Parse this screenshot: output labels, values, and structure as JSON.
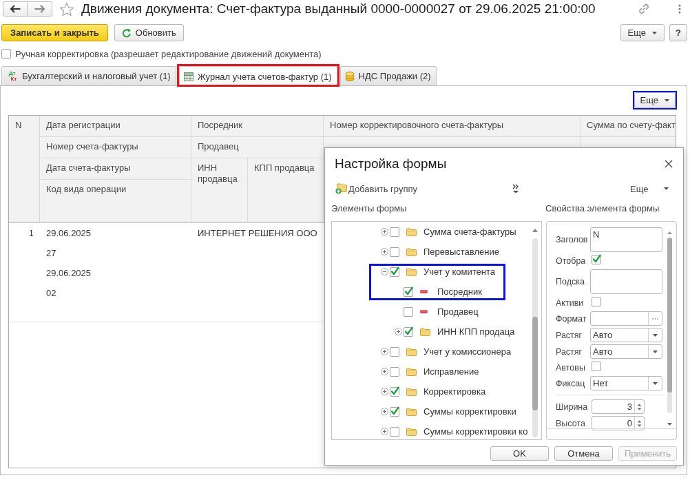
{
  "window": {
    "title": "Движения документа: Счет-фактура выданный 0000-0000027 от 29.06.2025 21:00:00"
  },
  "toolbar": {
    "buttons": [
      {
        "label": "Записать и закрыть",
        "kind": "primary"
      },
      {
        "label": "Обновить",
        "kind": "secondary"
      }
    ],
    "more_button": "Еще",
    "help_button": "?"
  },
  "manual_edit": {
    "label": "Ручная корректировка (разрешает редактирование движений документа)",
    "checked": false
  },
  "tabs": [
    {
      "label": "Бухгалтерский и налоговый учет (1)",
      "badge": [
        "Дт",
        "Кт"
      ],
      "selected": false,
      "highlighted": false
    },
    {
      "label": "Журнал учета счетов-фактур (1)",
      "selected": true,
      "highlighted": true
    },
    {
      "label": "НДС Продажи (2)",
      "selected": false,
      "highlighted": false
    }
  ],
  "table": {
    "more_button": {
      "label": "Еще",
      "highlighted": true
    },
    "columns": [
      {
        "lines": [
          "N"
        ]
      },
      {
        "lines": [
          "Дата регистрации",
          "Номер счета-фактуры",
          "Дата счета-фактуры",
          "Код вида операции"
        ]
      },
      {
        "lines": [
          "Посредник",
          "Продавец"
        ],
        "sub_columns": [
          "ИНН продавца",
          "КПП продавца"
        ]
      },
      {
        "lines": [
          "Номер корректировочного счета-фактуры"
        ]
      },
      {
        "lines": [
          "Сумма по счету-факт"
        ]
      }
    ],
    "rows": [
      {
        "cells": [
          [
            "1"
          ],
          [
            "29.06.2025",
            "27",
            "29.06.2025",
            "02"
          ],
          [
            "ИНТЕРНЕТ РЕШЕНИЯ ООО"
          ]
        ]
      }
    ]
  },
  "dialog": {
    "title": "Настройка формы",
    "add_group_button": "Добавить группу",
    "more_button": "Еще",
    "elements_label": "Элементы формы",
    "properties_label": "Свойства элемента формы",
    "tree": [
      {
        "label": "Сумма счета-фактуры",
        "kind": "group",
        "checked": false,
        "expanded": false,
        "highlighted": false
      },
      {
        "label": "Перевыставление",
        "kind": "group",
        "checked": false,
        "expanded": false,
        "highlighted": false
      },
      {
        "label": "Учет у комитента",
        "kind": "group",
        "checked": true,
        "expanded": true,
        "highlighted": true,
        "children": [
          {
            "label": "Посредник",
            "kind": "field",
            "checked": true,
            "highlighted": true
          },
          {
            "label": "Продавец",
            "kind": "field",
            "checked": false,
            "highlighted": false
          },
          {
            "label": "ИНН КПП продаца",
            "kind": "group",
            "checked": true,
            "expanded": false,
            "highlighted": false
          }
        ]
      },
      {
        "label": "Учет у комиссионера",
        "kind": "group",
        "checked": false,
        "expanded": false,
        "highlighted": false
      },
      {
        "label": "Исправление",
        "kind": "group",
        "checked": false,
        "expanded": false,
        "highlighted": false
      },
      {
        "label": "Корректировка",
        "kind": "group",
        "checked": true,
        "expanded": false,
        "highlighted": false
      },
      {
        "label": "Суммы корректировки",
        "kind": "group",
        "checked": true,
        "expanded": false,
        "highlighted": false
      },
      {
        "label": "Суммы корректировки ко",
        "kind": "group",
        "checked": false,
        "expanded": false,
        "highlighted": false
      }
    ],
    "properties": [
      {
        "label": "Заголов",
        "kind": "textarea",
        "value": "N"
      },
      {
        "label": "Отобра",
        "kind": "checkbox",
        "checked": true
      },
      {
        "label": "Подска",
        "kind": "textarea"
      },
      {
        "label": "Активи",
        "kind": "checkbox",
        "checked": false
      },
      {
        "label": "Формат",
        "kind": "picker"
      },
      {
        "label": "Растяг",
        "kind": "select",
        "value": "Авто"
      },
      {
        "label": "Растяг",
        "kind": "select",
        "value": "Авто"
      },
      {
        "label": "Автовы",
        "kind": "checkbox",
        "checked": false
      },
      {
        "label": "Фиксац",
        "kind": "select",
        "value": "Нет"
      },
      {
        "kind": "separator"
      },
      {
        "label": "Ширина",
        "kind": "number",
        "value": "3"
      },
      {
        "label": "Высота",
        "kind": "number",
        "value": "0"
      }
    ],
    "buttons": [
      {
        "label": "OK",
        "disabled": false
      },
      {
        "label": "Отмена",
        "disabled": false
      },
      {
        "label": "Применить",
        "disabled": true
      }
    ]
  }
}
